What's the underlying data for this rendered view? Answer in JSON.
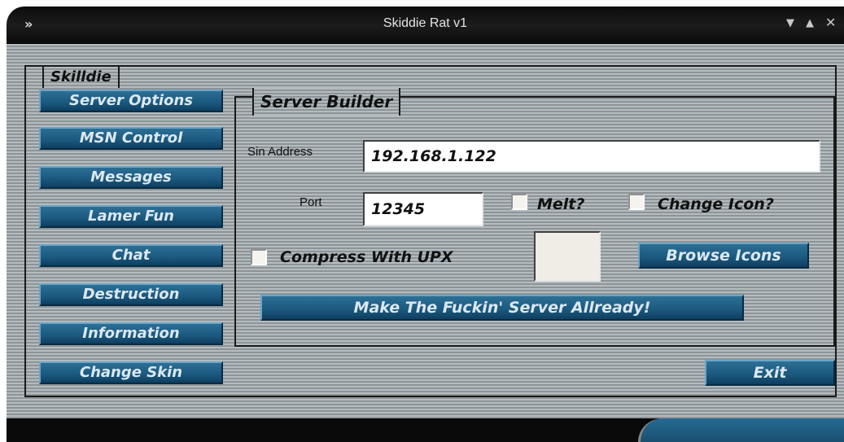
{
  "window": {
    "title": "Skiddie Rat v1"
  },
  "tabs": {
    "main": "Skilldie",
    "builder": "Server Builder"
  },
  "nav": [
    "Server Options",
    "MSN Control",
    "Messages",
    "Lamer Fun",
    "Chat",
    "Destruction",
    "Information",
    "Change Skin"
  ],
  "builder": {
    "address_label": "Sin Address",
    "address_value": "192.168.1.122",
    "port_label": "Port",
    "port_value": "12345",
    "melt_label": "Melt?",
    "change_icon_label": "Change Icon?",
    "compress_label": "Compress With UPX",
    "browse_label": "Browse Icons",
    "make_label": "Make The Fuckin' Server Allready!"
  },
  "exit_label": "Exit",
  "colors": {
    "button": "#1c5a80",
    "stripe_light": "#b4bcc0",
    "stripe_dark": "#8c9498"
  }
}
